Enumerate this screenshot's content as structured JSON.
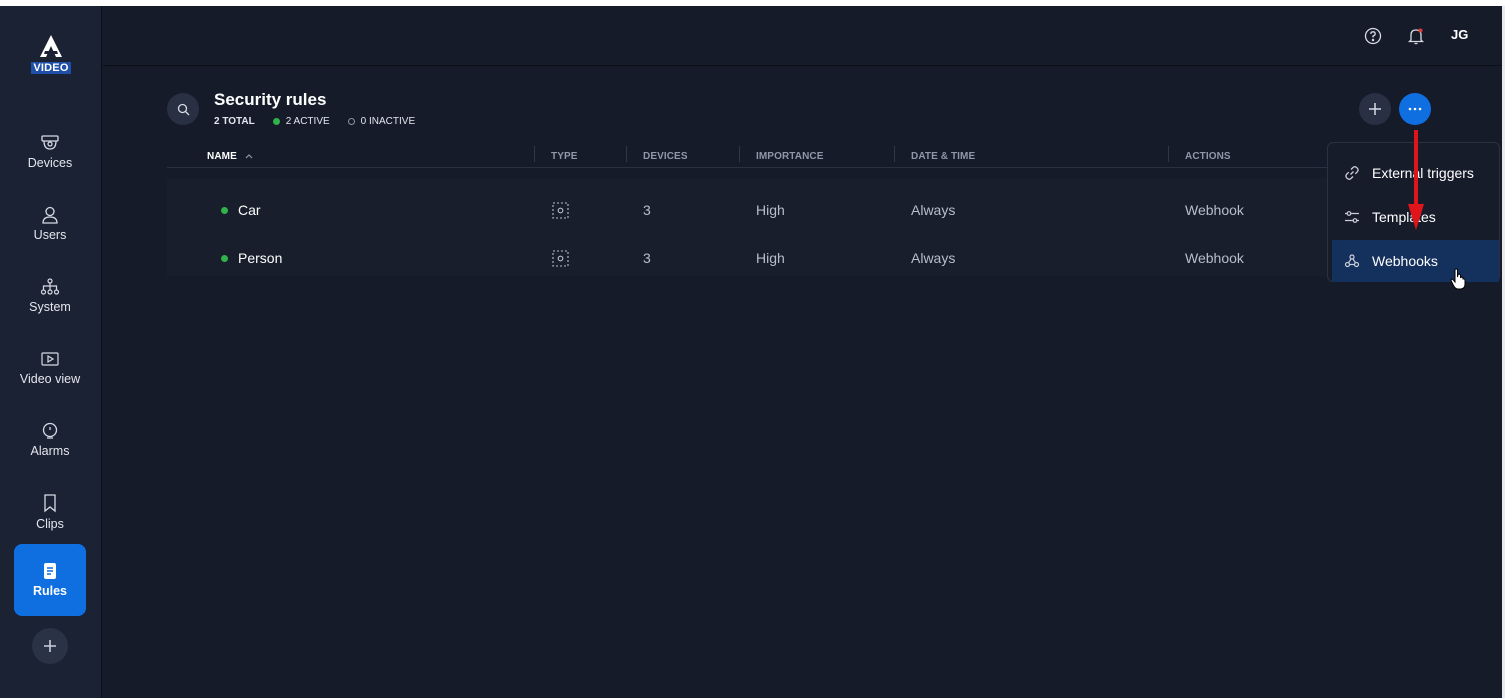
{
  "sidebar": {
    "logo_text": "VIDEO",
    "items": [
      {
        "label": "Devices",
        "icon": "camera-icon"
      },
      {
        "label": "Users",
        "icon": "user-icon"
      },
      {
        "label": "System",
        "icon": "network-icon"
      },
      {
        "label": "Video view",
        "icon": "play-icon"
      },
      {
        "label": "Alarms",
        "icon": "alarm-icon"
      },
      {
        "label": "Clips",
        "icon": "bookmark-icon"
      },
      {
        "label": "Rules",
        "icon": "document-icon",
        "active": true
      }
    ]
  },
  "topbar": {
    "user_initials": "JG"
  },
  "page": {
    "title": "Security rules",
    "total": "2 TOTAL",
    "active": "2 ACTIVE",
    "inactive": "0 INACTIVE"
  },
  "table": {
    "columns": [
      "NAME",
      "TYPE",
      "DEVICES",
      "IMPORTANCE",
      "DATE & TIME",
      "ACTIONS"
    ],
    "rows": [
      {
        "name": "Car",
        "devices": "3",
        "importance": "High",
        "date_time": "Always",
        "actions": "Webhook"
      },
      {
        "name": "Person",
        "devices": "3",
        "importance": "High",
        "date_time": "Always",
        "actions": "Webhook"
      }
    ]
  },
  "dropdown": {
    "items": [
      {
        "label": "External triggers",
        "icon": "link-icon"
      },
      {
        "label": "Templates",
        "icon": "sliders-icon"
      },
      {
        "label": "Webhooks",
        "icon": "webhook-icon",
        "active": true
      }
    ]
  },
  "colors": {
    "accent": "#0f6fe0",
    "active_status": "#2fb34a",
    "background": "#151b29",
    "annotation_arrow": "#e0141b"
  }
}
